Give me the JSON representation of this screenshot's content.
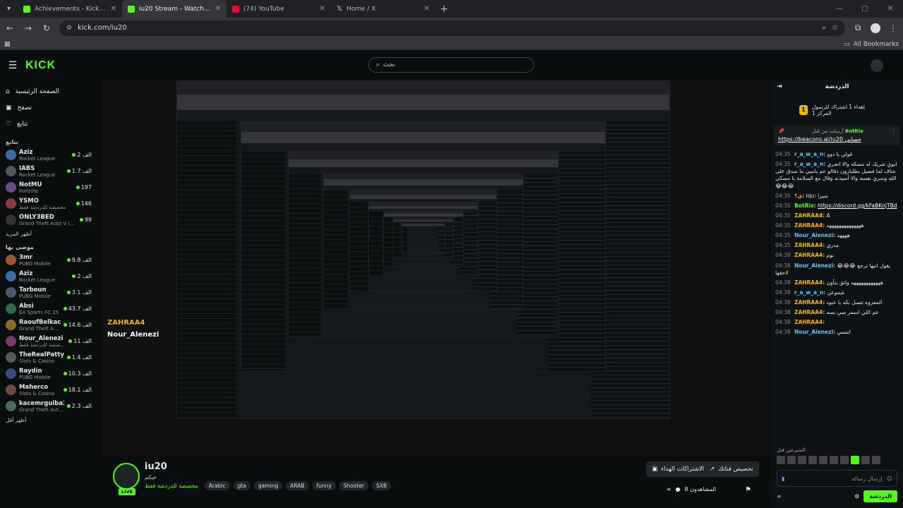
{
  "browser": {
    "tabs": [
      {
        "title": "Achievements - Kick Dashboard",
        "fav_color": "#53fc18",
        "active": false
      },
      {
        "title": "iu20 Stream - Watch Live on Kick",
        "fav_color": "#53fc18",
        "active": true
      },
      {
        "title": "(74) YouTube",
        "fav_color": "#ff0033",
        "active": false
      },
      {
        "title": "Home / X",
        "fav_color": "#ffffff",
        "active": false
      }
    ],
    "new_tab": "+",
    "url": "kick.com/iu20",
    "bookmarks_label": "All Bookmarks"
  },
  "header": {
    "logo": "KICK",
    "search_placeholder": "بحث"
  },
  "sidebar": {
    "nav": [
      {
        "label": "الصفحة الرئيسية",
        "icon": "home-icon"
      },
      {
        "label": "تصفح",
        "icon": "browse-icon"
      },
      {
        "label": "تتابع",
        "icon": "heart-icon"
      }
    ],
    "following_title": "تتابع",
    "following": [
      {
        "name": "Aziz",
        "game": "Rocket League",
        "viewers": "الف 2",
        "color": "#3b6ea8"
      },
      {
        "name": "IABS",
        "game": "Rocket League",
        "viewers": "الف 1.7",
        "color": "#555"
      },
      {
        "name": "NotMU",
        "game": "Fortnite",
        "viewers": "197",
        "color": "#6b4a8a"
      },
      {
        "name": "YSMO",
        "game": "مخصصة للدردشة فقط",
        "viewers": "146",
        "color": "#8a3a3a"
      },
      {
        "name": "ONLY3BED",
        "game": "Grand Theft Auto V (G...",
        "viewers": "99",
        "color": "#333"
      }
    ],
    "show_more": "أظهر المزيد",
    "recommended_title": "موصى بها",
    "recommended": [
      {
        "name": "3mr",
        "game": "PUBG Mobile",
        "viewers": "الف 9.8",
        "color": "#a0552e"
      },
      {
        "name": "Aziz",
        "game": "Rocket League",
        "viewers": "الف 2",
        "color": "#3b6ea8"
      },
      {
        "name": "Tarboun",
        "game": "PUBG Mobile",
        "viewers": "الف 3.1",
        "color": "#4a5a6a"
      },
      {
        "name": "Absi",
        "game": "EA Sports FC 25",
        "viewers": "الف 43.7",
        "color": "#2f6a4a"
      },
      {
        "name": "RaoufBelkacemi",
        "game": "Grand Theft Auto V",
        "viewers": "الف 14.6",
        "color": "#8a6a2a"
      },
      {
        "name": "Nour_Alenezi",
        "game": "مخصصة للدردشة فقط",
        "viewers": "الف 11",
        "color": "#7a3a6a"
      },
      {
        "name": "TheRealPatty",
        "game": "Slots & Casino",
        "viewers": "الف 1.4",
        "color": "#5a5a5a"
      },
      {
        "name": "Raydin",
        "game": "PUBG Mobile",
        "viewers": "الف 10.3",
        "color": "#3a4a7a"
      },
      {
        "name": "Maherco",
        "game": "Slots & Casino",
        "viewers": "الف 18.1",
        "color": "#6a4a3a"
      },
      {
        "name": "kacemrguiba213",
        "game": "Grand Theft Auto ...",
        "viewers": "الف 2.3",
        "color": "#4a6a5a"
      }
    ],
    "show_less": "أظهر أقل"
  },
  "overlay": {
    "name1": "ZAHRAA4",
    "name2": "Nour_Alenezi"
  },
  "stream_info": {
    "name": "iu20",
    "live": "LIVE",
    "category": "حيكم",
    "category_link": "مخصصة للدردشة فقط",
    "tags": [
      "Arabic",
      "gta",
      "gaming",
      "ARAB",
      "funny",
      "Shooter",
      "SXB"
    ],
    "btn_subs": "الاشتراكات الهداء",
    "btn_custom": "تخصيص قناتك",
    "viewers": "8 المشاهدون"
  },
  "chat": {
    "title": "الدردشة",
    "pinned_sub": "إهداء 1 اشتراك للرسول المركز 1",
    "pinned_by": "أرسلت من قبل",
    "pinned_bot": "BotRix",
    "pinned_text": "حسابي",
    "pinned_link": "https://beacons.ai/iu20",
    "messages": [
      {
        "time": "04:35",
        "user": "r_a_w_a_n:",
        "cls": "c",
        "text": "قولي يا دوو"
      },
      {
        "time": "04:35",
        "user": "r_a_w_a_n:",
        "cls": "c",
        "text": "ابوي شريك له مسكه والا انجري شاف لما فضيل بطلبارون دقالو عم يابنيي ما صدق على الله وسري نفسه والا أسيدنه وقال مع السلامة يا مسكي 😂😂😂"
      },
      {
        "time": "04:35",
        "user": "ي؟:",
        "cls": "",
        "text": "iqu: سيرا"
      },
      {
        "time": "04:35",
        "user": "BotRix:",
        "cls": "g",
        "text": "",
        "link": "https://discord.gg/kFaBKnjTBd"
      },
      {
        "time": "04:35",
        "user": "ZAHRAA4:",
        "cls": "",
        "text": "A"
      },
      {
        "time": "04:35",
        "user": "ZAHRAA4:",
        "cls": "",
        "text": "ههههههههههههههه"
      },
      {
        "time": "04:35",
        "user": "Nour_Alenezi:",
        "cls": "c",
        "text": "ههههه"
      },
      {
        "time": "04:35",
        "user": "ZAHRAA4:",
        "cls": "",
        "text": "مدري"
      },
      {
        "time": "04:38",
        "user": "ZAHRAA4:",
        "cls": "",
        "text": "نوم"
      },
      {
        "time": "04:38",
        "user": "Nour_Alenezi:",
        "cls": "c",
        "text": "يقول انيها ترجع 😂😂😂 لاحقها"
      },
      {
        "time": "04:38",
        "user": "ZAHRAA4:",
        "cls": "",
        "text": "ههههههههههههه واثق بتأون"
      },
      {
        "time": "04:38",
        "user": "r_a_w_a_n:",
        "cls": "c",
        "text": "شموعن"
      },
      {
        "time": "04:38",
        "user": "ZAHRAA4:",
        "cls": "",
        "text": "المعزوه تتصل بكه يا عبود"
      },
      {
        "time": "04:38",
        "user": "ZAHRAA4:",
        "cls": "",
        "text": "عم اللي اسمر مبي بسه"
      },
      {
        "time": "04:38",
        "user": "ZAHRAA4:",
        "cls": "",
        "text": ""
      },
      {
        "time": "04:38",
        "user": "Nour_Alenezi:",
        "cls": "c",
        "text": "ابتسي"
      }
    ],
    "senders_label": "المتبرعين قبل",
    "input_placeholder": "إرسال رسالة",
    "send": "الدردشة"
  }
}
